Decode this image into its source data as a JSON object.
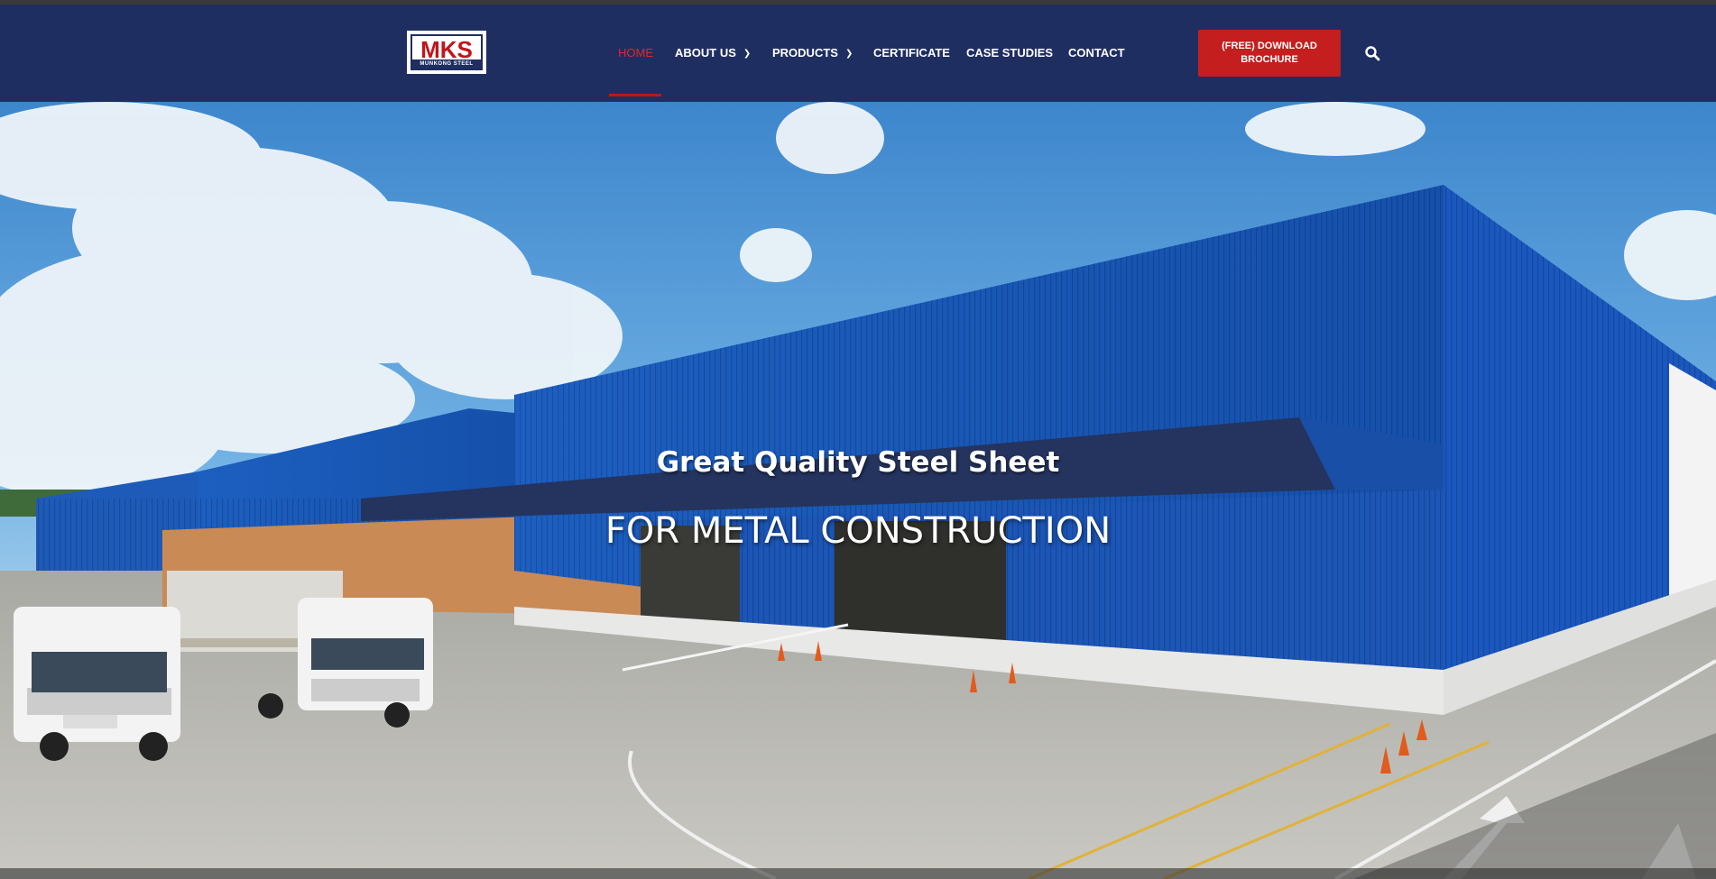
{
  "brand": {
    "logo_text": "MKS",
    "logo_subtext": "MUNKONG STEEL",
    "colors": {
      "navy": "#1f2e61",
      "red": "#c41e1e",
      "active_link": "#d52d27"
    }
  },
  "nav": {
    "items": [
      {
        "label": "HOME",
        "active": true
      },
      {
        "label": "ABOUT US",
        "has_dropdown": true
      },
      {
        "label": "PRODUCTS",
        "has_dropdown": true
      },
      {
        "label": "CERTIFICATE"
      },
      {
        "label": "CASE STUDIES"
      },
      {
        "label": "CONTACT"
      }
    ],
    "cta_label": "(FREE) DOWNLOAD BROCHURE",
    "search_icon": "search-icon",
    "dropdown_icon": "chevron-down-icon"
  },
  "hero": {
    "eyebrow": "Great Quality Steel Sheet",
    "title": "FOR METAL CONSTRUCTION"
  }
}
